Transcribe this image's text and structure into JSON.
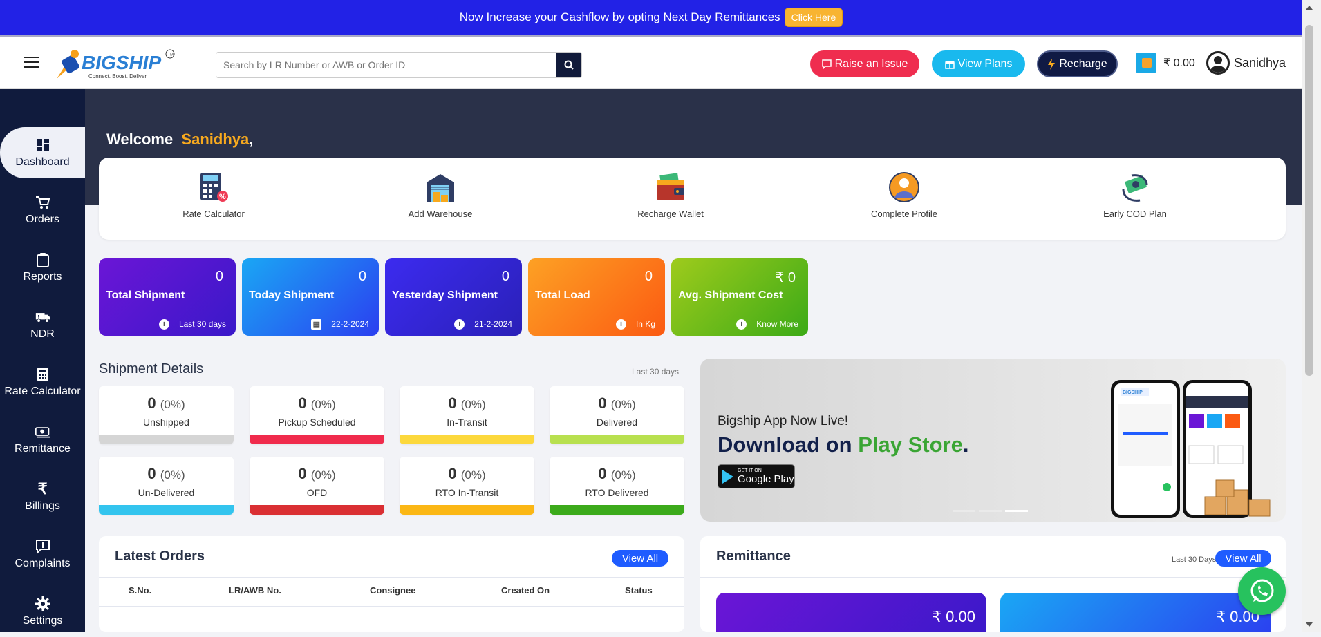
{
  "banner": {
    "text": "Now Increase your Cashflow by opting Next Day Remittances",
    "cta": "Click Here"
  },
  "header": {
    "brand": "BIGSHIP",
    "tagline": "Connect. Boost. Deliver",
    "search_placeholder": "Search by LR Number or AWB or Order ID",
    "raise_issue": "Raise an Issue",
    "view_plans": "View Plans",
    "recharge": "Recharge",
    "wallet_balance": "₹ 0.00",
    "user_name": "Sanidhya"
  },
  "sidebar": {
    "items": [
      {
        "label": "Dashboard",
        "icon": "dashboard-icon"
      },
      {
        "label": "Orders",
        "icon": "cart-icon"
      },
      {
        "label": "Reports",
        "icon": "clipboard-icon"
      },
      {
        "label": "NDR",
        "icon": "truck-icon"
      },
      {
        "label": "Rate Calculator",
        "icon": "calculator-icon"
      },
      {
        "label": "Remittance",
        "icon": "money-icon"
      },
      {
        "label": "Billings",
        "icon": "rupee-icon"
      },
      {
        "label": "Complaints",
        "icon": "alert-message-icon"
      },
      {
        "label": "Settings",
        "icon": "gear-icon"
      }
    ]
  },
  "welcome": {
    "prefix": "Welcome",
    "name": "Sanidhya",
    "suffix": ","
  },
  "quick_actions": [
    {
      "label": "Rate Calculator",
      "icon": "rate-calculator-icon"
    },
    {
      "label": "Add Warehouse",
      "icon": "warehouse-icon"
    },
    {
      "label": "Recharge Wallet",
      "icon": "wallet-icon"
    },
    {
      "label": "Complete Profile",
      "icon": "profile-icon"
    },
    {
      "label": "Early COD Plan",
      "icon": "cod-money-icon"
    }
  ],
  "stats": [
    {
      "value": "0",
      "label": "Total Shipment",
      "foot": "Last 30 days",
      "color_from": "#6b16d6",
      "color_to": "#3a18c9"
    },
    {
      "value": "0",
      "label": "Today Shipment",
      "foot": "22-2-2024",
      "color_from": "#1aa7f4",
      "color_to": "#2b3ff0"
    },
    {
      "value": "0",
      "label": "Yesterday Shipment",
      "foot": "21-2-2024",
      "color_from": "#3c2bef",
      "color_to": "#2a20b8"
    },
    {
      "value": "0",
      "label": "Total Load",
      "foot": "In Kg",
      "color_from": "#fda124",
      "color_to": "#fb5a12"
    },
    {
      "value": "₹ 0",
      "label": "Avg. Shipment Cost",
      "foot": "Know More",
      "color_from": "#9ecb1c",
      "color_to": "#3caa17"
    }
  ],
  "shipment_details": {
    "title": "Shipment Details",
    "range": "Last 30 days",
    "cards": [
      {
        "count": "0",
        "pct": "(0%)",
        "label": "Unshipped",
        "color": "#d5d5d5"
      },
      {
        "count": "0",
        "pct": "(0%)",
        "label": "Pickup Scheduled",
        "color": "#f02b4c"
      },
      {
        "count": "0",
        "pct": "(0%)",
        "label": "In-Transit",
        "color": "#fcd83c"
      },
      {
        "count": "0",
        "pct": "(0%)",
        "label": "Delivered",
        "color": "#b8e04f"
      },
      {
        "count": "0",
        "pct": "(0%)",
        "label": "Un-Delivered",
        "color": "#33c4ee"
      },
      {
        "count": "0",
        "pct": "(0%)",
        "label": "OFD",
        "color": "#da2f33"
      },
      {
        "count": "0",
        "pct": "(0%)",
        "label": "RTO In-Transit",
        "color": "#fbb715"
      },
      {
        "count": "0",
        "pct": "(0%)",
        "label": "RTO Delivered",
        "color": "#3caa1b"
      }
    ]
  },
  "promo": {
    "line1": "Bigship App Now Live!",
    "line2_a": "Download on",
    "line2_b": "Play Store",
    "line2_c": ".",
    "badge_small": "GET IT ON",
    "badge_big": "Google Play"
  },
  "latest_orders": {
    "title": "Latest Orders",
    "view_all": "View All",
    "columns": [
      "S.No.",
      "LR/AWB No.",
      "Consignee",
      "Created On",
      "Status"
    ]
  },
  "remittance": {
    "title": "Remittance",
    "range": "Last 30 Days",
    "view_all": "View All",
    "cards": [
      {
        "amount": "₹ 0.00",
        "color_from": "#6b16d6",
        "color_to": "#3a18c9"
      },
      {
        "amount": "₹ 0.00",
        "color_from": "#1aa7f4",
        "color_to": "#2b3ff0"
      }
    ]
  }
}
